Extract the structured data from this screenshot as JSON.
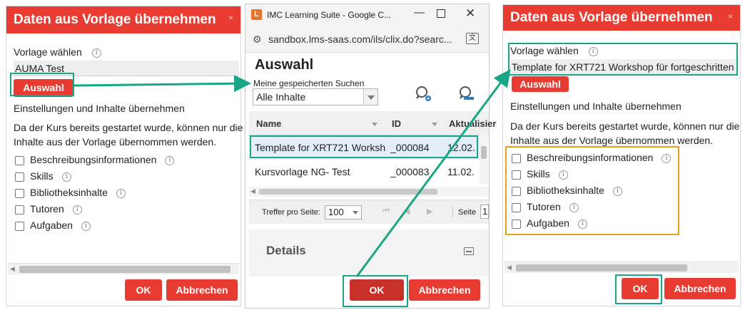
{
  "left_dialog": {
    "title": "Daten aus Vorlage übernehmen",
    "close_label": "×",
    "template_label": "Vorlage wählen",
    "template_value": "AUMA Test",
    "select_button": "Auswahl",
    "section_title": "Einstellungen und Inhalte übernehmen",
    "note": "Da der Kurs bereits gestartet wurde, können nur die Inhalte aus der Vorlage übernommen werden.",
    "options": [
      {
        "label": "Beschreibungsinformationen",
        "checked": false
      },
      {
        "label": "Skills",
        "checked": false
      },
      {
        "label": "Bibliotheksinhalte",
        "checked": false
      },
      {
        "label": "Tutoren",
        "checked": false
      },
      {
        "label": "Aufgaben",
        "checked": false
      }
    ],
    "ok_button": "OK",
    "cancel_button": "Abbrechen"
  },
  "browser": {
    "app_icon_letter": "L",
    "window_title": "IMC Learning Suite - Google C...",
    "url": "sandbox.lms-saas.com/ils/clix.do?searc...",
    "heading": "Auswahl",
    "saved_searches_label": "Meine gespeicherten Suchen",
    "saved_searches_value": "Alle Inhalte",
    "columns": {
      "name": "Name",
      "id": "ID",
      "updated": "Aktualisier"
    },
    "rows": [
      {
        "name": "Template for XRT721 Worksh",
        "id": "_000084",
        "updated": "12.02."
      },
      {
        "name": "Kursvorlage NG- Test",
        "id": "_000083",
        "updated": "11.02."
      }
    ],
    "per_page_label": "Treffer pro Seite:",
    "per_page_value": "100",
    "page_label": "Seite",
    "page_value": "1",
    "details_title": "Details",
    "ok_button": "OK",
    "cancel_button": "Abbrechen"
  },
  "right_dialog": {
    "title": "Daten aus Vorlage übernehmen",
    "close_label": "×",
    "template_label": "Vorlage wählen",
    "template_value": "Template for XRT721 Workshop für fortgeschritten",
    "select_button": "Auswahl",
    "section_title": "Einstellungen und Inhalte übernehmen",
    "note": "Da der Kurs bereits gestartet wurde, können nur die Inhalte aus der Vorlage übernommen werden.",
    "options": [
      {
        "label": "Beschreibungsinformationen",
        "checked": false
      },
      {
        "label": "Skills",
        "checked": false
      },
      {
        "label": "Bibliotheksinhalte",
        "checked": false
      },
      {
        "label": "Tutoren",
        "checked": false
      },
      {
        "label": "Aufgaben",
        "checked": false
      }
    ],
    "ok_button": "OK",
    "cancel_button": "Abbrechen"
  },
  "colors": {
    "accent_red": "#e83b32",
    "highlight_teal": "#1aa585",
    "highlight_orange": "#e3a21a"
  }
}
